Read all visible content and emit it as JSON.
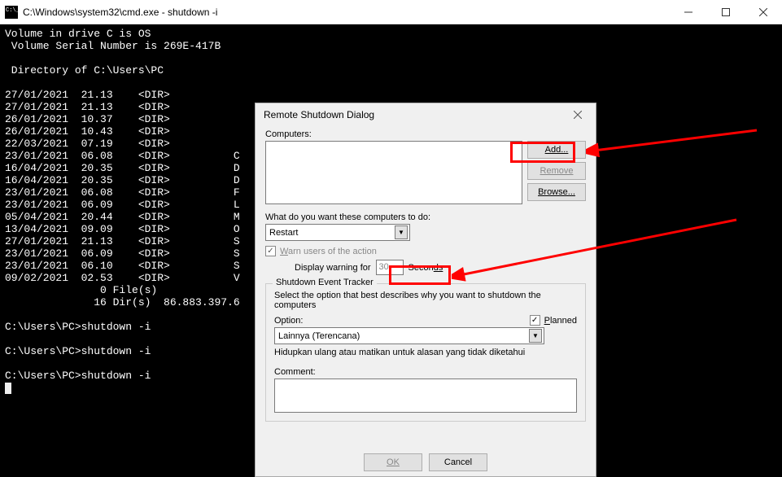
{
  "window": {
    "title": "C:\\Windows\\system32\\cmd.exe - shutdown  -i",
    "minimize": "—",
    "maximize": "▢",
    "close": "✕"
  },
  "console": {
    "lines": [
      "Volume in drive C is OS",
      " Volume Serial Number is 269E-417B",
      "",
      " Directory of C:\\Users\\PC",
      "",
      "27/01/2021  21.13    <DIR>",
      "27/01/2021  21.13    <DIR>",
      "26/01/2021  10.37    <DIR>",
      "26/01/2021  10.43    <DIR>",
      "22/03/2021  07.19    <DIR>",
      "23/01/2021  06.08    <DIR>          C",
      "16/04/2021  20.35    <DIR>          D",
      "16/04/2021  20.35    <DIR>          D",
      "23/01/2021  06.08    <DIR>          F",
      "23/01/2021  06.09    <DIR>          L",
      "05/04/2021  20.44    <DIR>          M",
      "13/04/2021  09.09    <DIR>          O",
      "27/01/2021  21.13    <DIR>          S",
      "23/01/2021  06.09    <DIR>          S",
      "23/01/2021  06.10    <DIR>          S",
      "09/02/2021  02.53    <DIR>          V",
      "               0 File(s)",
      "              16 Dir(s)  86.883.397.6",
      "",
      "C:\\Users\\PC>shutdown -i",
      "",
      "C:\\Users\\PC>shutdown -i",
      "",
      "C:\\Users\\PC>shutdown -i",
      ""
    ]
  },
  "dialog": {
    "title": "Remote Shutdown Dialog",
    "close": "✕",
    "computers_label": "Computers:",
    "btn_add": "Add...",
    "btn_remove": "Remove",
    "btn_browse": "Browse...",
    "action_label": "What do you want these computers to do:",
    "action_value": "Restart",
    "warn_prefix": "W",
    "warn_rest": "arn users of the action",
    "display_prefix": "Display warning for",
    "display_seconds": "30",
    "seconds_suffix_pre": "Secon",
    "seconds_suffix_post": "ds",
    "tracker_legend": "Shutdown Event Tracker",
    "tracker_desc": "Select the option that best describes why you want to shutdown the computers",
    "option_label": "Option:",
    "planned_prefix": "P",
    "planned_rest": "lanned",
    "option_value": "Lainnya (Terencana)",
    "option_desc": "Hidupkan ulang atau matikan untuk alasan yang tidak diketahui",
    "comment_label": "Comment:",
    "btn_ok": "OK",
    "btn_cancel": "Cancel"
  }
}
